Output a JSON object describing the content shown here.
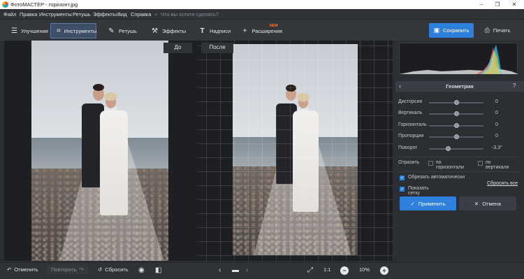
{
  "window": {
    "title": "ФотоМАСТЕР - горизонт.jpg",
    "min": "–",
    "max": "❐",
    "close": "✕"
  },
  "menu": {
    "items": [
      "Файл",
      "Правка",
      "Инструменты",
      "Ретушь",
      "Эффекты",
      "Вид",
      "Справка"
    ],
    "search_placeholder": "Что вы хотите сделать?"
  },
  "toolbar": {
    "tabs": [
      {
        "label": "Улучшения",
        "icon": "sliders-icon",
        "active": false
      },
      {
        "label": "Инструменты",
        "icon": "crop-icon",
        "active": true
      },
      {
        "label": "Ретушь",
        "icon": "brush-icon",
        "active": false
      },
      {
        "label": "Эффекты",
        "icon": "wand-icon",
        "active": false
      },
      {
        "label": "Надписи",
        "icon": "text-icon",
        "active": false
      },
      {
        "label": "Расширения",
        "icon": "plus-icon",
        "active": false,
        "badge": "NEW"
      }
    ],
    "save_label": "Сохранить",
    "print_label": "Печать"
  },
  "compare": {
    "before_label": "До",
    "after_label": "После"
  },
  "bottom": {
    "undo_label": "Отменить",
    "redo_label": "Повторить",
    "reset_label": "Сбросить",
    "one_to_one": "1:1",
    "zoom": "10%"
  },
  "panel": {
    "title": "Геометрия",
    "help": "?",
    "sliders": [
      {
        "label": "Дисторсия",
        "value": "0",
        "position": 0.5
      },
      {
        "label": "Вертикаль",
        "value": "0",
        "position": 0.5
      },
      {
        "label": "Горизонталь",
        "value": "0",
        "position": 0.5
      },
      {
        "label": "Пропорции",
        "value": "0",
        "position": 0.5
      },
      {
        "label": "Поворот",
        "value": "-3,3°",
        "position": 0.35
      }
    ],
    "flip_label": "Отразить",
    "flip_h": "по горизонтали",
    "flip_v": "по вертикали",
    "auto_crop": "Обрезать автоматически",
    "show_grid": "Показать сетку",
    "reset_all": "Сбросить все",
    "apply": "Применить",
    "cancel": "Отмена"
  },
  "colors": {
    "accent": "#2f7fdc",
    "bg": "#2b2e33",
    "badge": "#ff7a2e"
  }
}
